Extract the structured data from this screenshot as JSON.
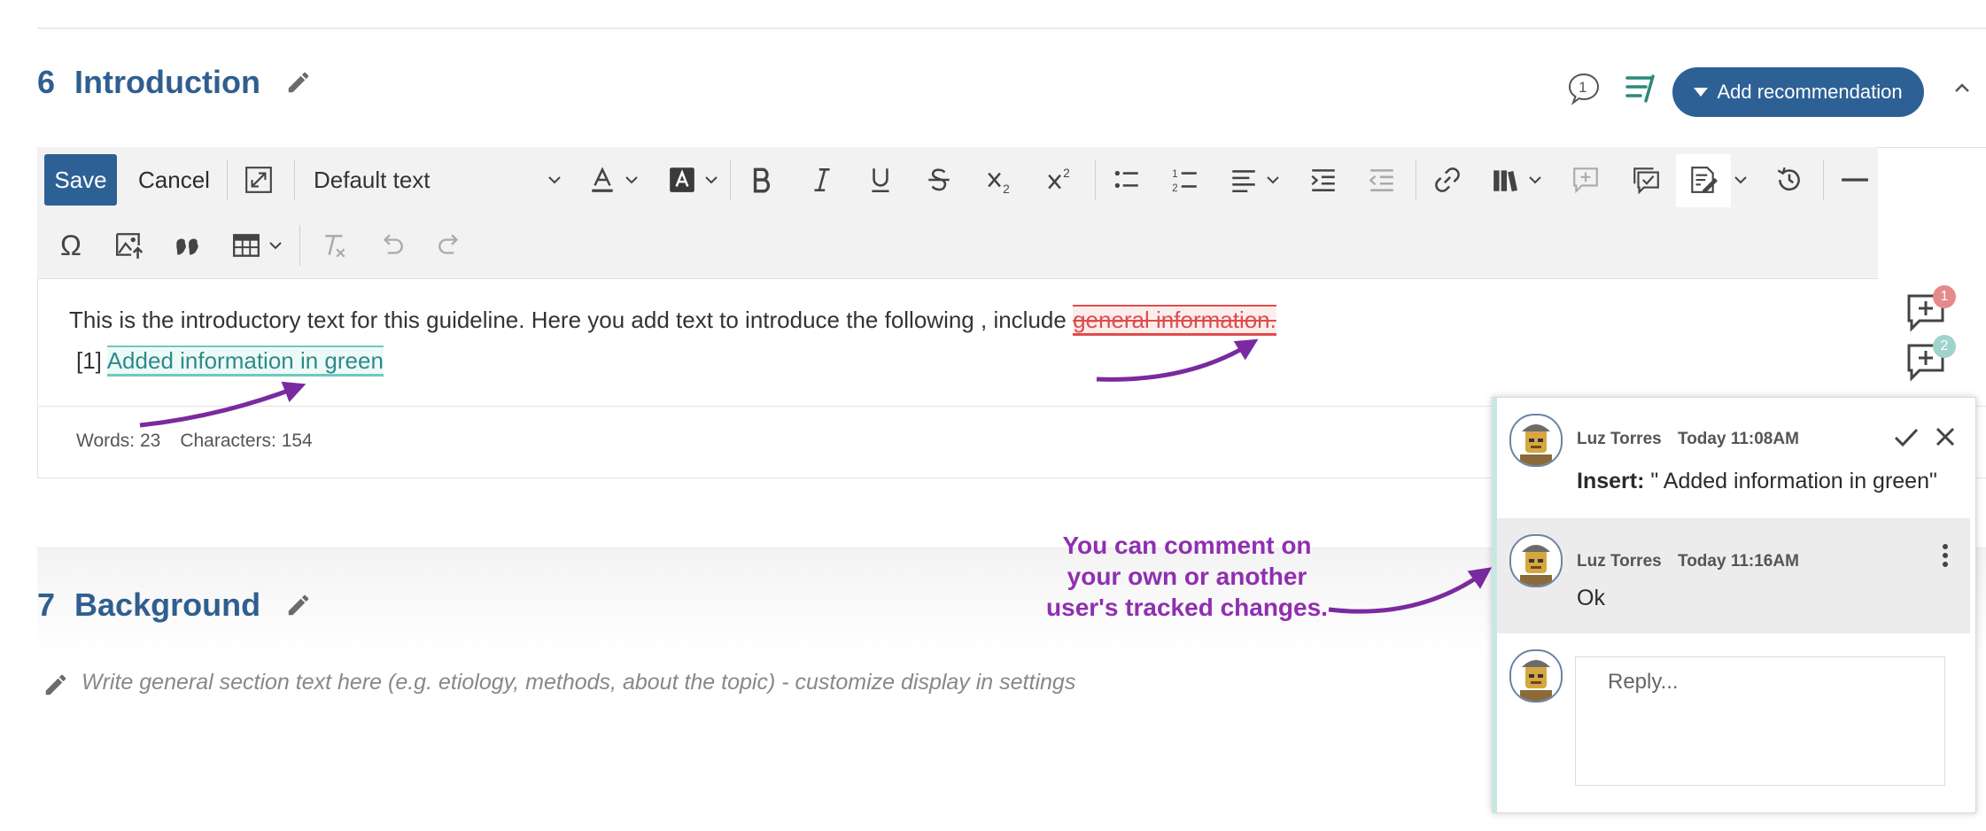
{
  "section6": {
    "number": "6",
    "title": "Introduction"
  },
  "header": {
    "comment_count": "1",
    "add_recommendation": "Add recommendation"
  },
  "toolbar": {
    "save": "Save",
    "cancel": "Cancel",
    "font_style": "Default text",
    "subscript_label": "X2",
    "superscript_label": "X2",
    "omega": "Ω"
  },
  "content": {
    "text": "This is the introductory text for this guideline. Here you add text to introduce the following , include ",
    "deleted": "general information.",
    "ref": "[1]",
    "inserted": "Added information in green"
  },
  "stats": {
    "words": "Words: 23",
    "characters": "Characters: 154"
  },
  "section7": {
    "number": "7",
    "title": "Background",
    "placeholder": "Write general section text here (e.g. etiology, methods, about the topic) - customize display in settings"
  },
  "markers": {
    "first_count": "1",
    "second_count": "2"
  },
  "annotation": "You can comment on your own or another user's tracked changes.",
  "comments": [
    {
      "author": "Luz Torres",
      "time": "Today 11:08AM",
      "label": "Insert:",
      "text": " \" Added information in green\""
    },
    {
      "author": "Luz Torres",
      "time": "Today 11:16AM",
      "text": "Ok"
    }
  ],
  "reply": {
    "placeholder": "Reply..."
  },
  "colors": {
    "primary": "#2d6195",
    "deleted": "#e04b4b",
    "inserted": "#2e8a8a",
    "annotation": "#8f2fb0",
    "arrow": "#7a2aa0"
  }
}
